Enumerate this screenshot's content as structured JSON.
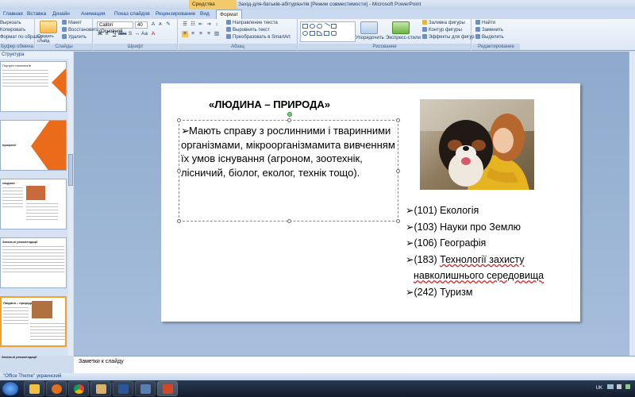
{
  "window": {
    "contextual_tab": "Средства рисования",
    "title": "Захід-для-батьків-абітурієнтів [Режим совместимости] - Microsoft PowerPoint"
  },
  "tabs": [
    {
      "label": "Главная"
    },
    {
      "label": "Вставка"
    },
    {
      "label": "Дизайн"
    },
    {
      "label": "Анимация"
    },
    {
      "label": "Показ слайдов"
    },
    {
      "label": "Рецензирование"
    },
    {
      "label": "Вид"
    },
    {
      "label": "Формат"
    }
  ],
  "ribbon": {
    "clipboard": {
      "cut": "Вырезать",
      "copy": "Копировать",
      "format_painter": "Формат по образцу",
      "label": "Буфер обмена"
    },
    "slides": {
      "new_slide": "Создать слайд",
      "layout": "Макет",
      "reset": "Восстановить",
      "delete": "Удалить",
      "label": "Слайды"
    },
    "font": {
      "font_name": "Calibri (Основной",
      "font_size": "40",
      "label": "Шрифт"
    },
    "paragraph": {
      "text_direction": "Направление текста",
      "align_text": "Выровнять текст",
      "smartart": "Преобразовать в SmartArt",
      "label": "Абзац"
    },
    "drawing": {
      "arrange": "Упорядочить",
      "quick_styles": "Экспресс-стили",
      "shape_fill": "Заливка фигуры",
      "shape_outline": "Контур фигуры",
      "shape_effects": "Эффекты для фигур",
      "label": "Рисование"
    },
    "editing": {
      "find": "Найти",
      "replace": "Заменить",
      "select": "Выделить",
      "label": "Редактирование"
    }
  },
  "left_panel": {
    "header": "Структура",
    "thumbnails": [
      {
        "title": "Портрет психологів"
      },
      {
        "title": "професії"
      },
      {
        "title": "людина"
      },
      {
        "title": "Загальні рекомендації"
      },
      {
        "title": "Людина – природа"
      },
      {
        "title": "Загальні рекомендації"
      }
    ]
  },
  "slide": {
    "title": "«ЛЮДИНА – ПРИРОДА»",
    "body": "Мають справу з рослинними і тваринними організмами, мікроорганізмамита вивченням їх умов існування (агроном, зоотехнік, лісничий, біолог, еколог, технік тощо).",
    "bullet_glyph": "➢",
    "specialties": [
      {
        "text": "(101) Екологія"
      },
      {
        "text": "(103) Науки про Землю"
      },
      {
        "text": "(106) Географія"
      },
      {
        "text_prefix": "(183) ",
        "text_wavy": "Технології захисту",
        "text_line2": "навколишнього середовища"
      },
      {
        "text": "(242) Туризм"
      }
    ]
  },
  "notes": {
    "placeholder": "Заметки к слайду"
  },
  "status": {
    "theme": "\"Office Theme\"",
    "language": "украинский"
  },
  "tray": {
    "lang": "UK"
  }
}
